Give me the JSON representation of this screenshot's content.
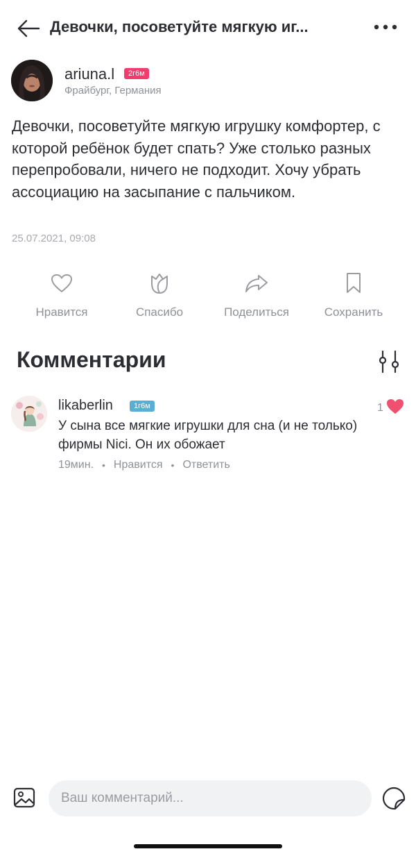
{
  "header": {
    "title": "Девочки, посоветуйте мягкую иг..."
  },
  "post": {
    "author": {
      "username": "ariuna.l",
      "child_age_badge": "2г6м",
      "location": "Фрайбург, Германия"
    },
    "text": "Девочки, посоветуйте мягкую игрушку комфортер, с которой ребёнок будет спать? Уже столько разных перепробовали, ничего не подходит. Хочу убрать ассоциацию на засыпание с пальчиком.",
    "date": "25.07.2021, 09:08",
    "actions": [
      {
        "label": "Нравится",
        "icon": "heart-outline-icon"
      },
      {
        "label": "Спасибо",
        "icon": "flower-icon"
      },
      {
        "label": "Поделиться",
        "icon": "share-arrow-icon"
      },
      {
        "label": "Сохранить",
        "icon": "bookmark-icon"
      }
    ]
  },
  "comments_section": {
    "title": "Комментарии",
    "filter_icon": "filter-sliders-icon",
    "comments": [
      {
        "username": "likaberlin",
        "child_age_badge": "1г6м",
        "text": "У сына все мягкие игрушки для сна (и не только) фирмы Nici. Он их обожает",
        "time": "19мин.",
        "like_action": "Нравится",
        "reply_action": "Ответить",
        "likes": "1"
      }
    ]
  },
  "composer": {
    "placeholder": "Ваш комментарий...",
    "image_icon": "image-icon",
    "sticker_icon": "sticker-icon"
  },
  "colors": {
    "accent_pink": "#ef3d6e",
    "badge_blue": "#5aaed1",
    "heart_filled": "#ef5070",
    "muted_text": "#8e9197"
  }
}
